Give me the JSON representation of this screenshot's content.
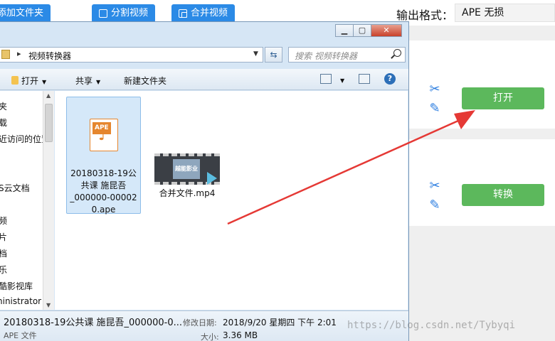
{
  "toolbar": {
    "add_file_label": "添加文件夹",
    "split_label": "分割视频",
    "merge_label": "合并视频",
    "format_label": "输出格式：",
    "format_value": "APE  无损"
  },
  "rows": [
    {
      "action_label": "打开"
    },
    {
      "action_label": "转换"
    }
  ],
  "dialog": {
    "address": "视频转换器",
    "search_placeholder": "搜索 视频转换器",
    "commands": {
      "open": "打开",
      "share": "共享",
      "new_folder": "新建文件夹"
    },
    "nav_items": [
      "夹",
      "载",
      "近访问的位置",
      "S云文档",
      "频",
      "片",
      "档",
      "乐",
      "酷影视库",
      "ninistrator"
    ],
    "files": [
      {
        "name": "20180318-19公共课 施昆吾_000000-000020.ape",
        "name_lines": [
          "20180318-19公",
          "共课 施昆吾",
          "_000000-00002",
          "0.ape"
        ],
        "selected": true,
        "icon": "ape-audio-icon",
        "icon_tag": "APE"
      },
      {
        "name": "合并文件.mp4",
        "selected": false,
        "icon": "video-thumbnail",
        "thumb_text": "越能影业"
      }
    ],
    "details": {
      "name": "20180318-19公共课 施昆吾_000000-0...",
      "type": "APE 文件",
      "modified_label": "修改日期:",
      "modified_value": "2018/9/20 星期四 下午 2:01",
      "size_label": "大小:",
      "size_value": "3.36 MB"
    }
  },
  "watermark": "https://blog.csdn.net/Tybyqi",
  "colors": {
    "accent_blue": "#2b8ae6",
    "green": "#5cb85c",
    "arrow": "#e53935"
  }
}
